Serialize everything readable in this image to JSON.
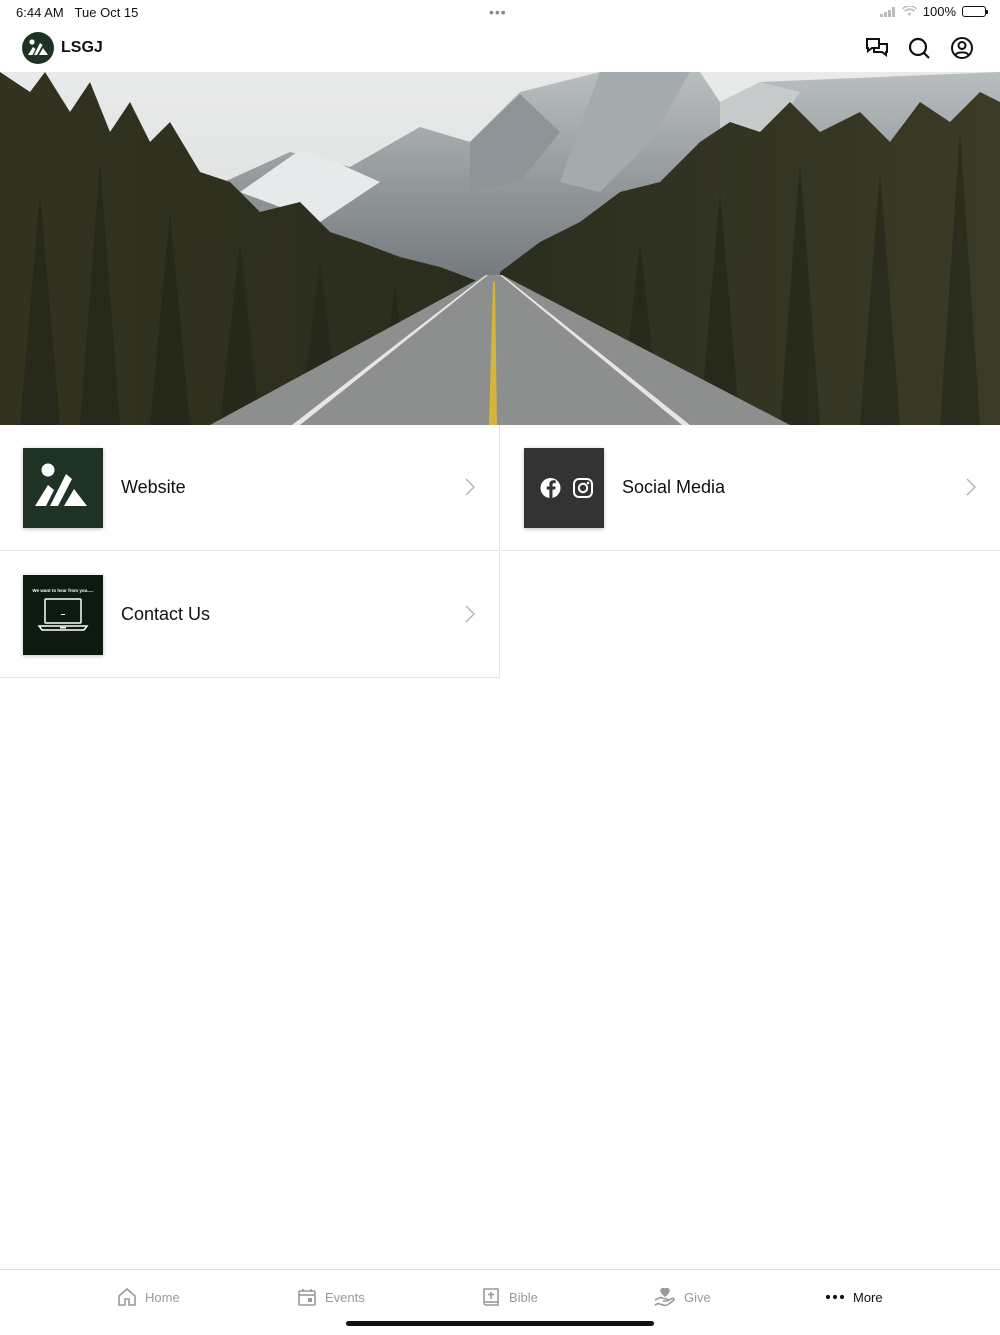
{
  "status_bar": {
    "time": "6:44 AM",
    "date": "Tue Oct 15",
    "battery": "100%"
  },
  "header": {
    "brand": "LSGJ",
    "icons": [
      "chat-icon",
      "search-icon",
      "profile-icon"
    ]
  },
  "hero": {
    "image": "mountain road through forest"
  },
  "tiles": [
    {
      "label": "Website",
      "thumb_color": "#1f3324"
    },
    {
      "label": "Social Media",
      "thumb_color": "#333333"
    },
    {
      "label": "Contact Us",
      "thumb_text": "We want to hear from you.....",
      "thumb_color": "#0c1a10"
    }
  ],
  "tabbar": {
    "items": [
      {
        "label": "Home",
        "icon": "home-icon"
      },
      {
        "label": "Events",
        "icon": "calendar-icon"
      },
      {
        "label": "Bible",
        "icon": "bible-icon"
      },
      {
        "label": "Give",
        "icon": "give-icon"
      },
      {
        "label": "More",
        "icon": "more-icon",
        "active": true
      }
    ]
  }
}
